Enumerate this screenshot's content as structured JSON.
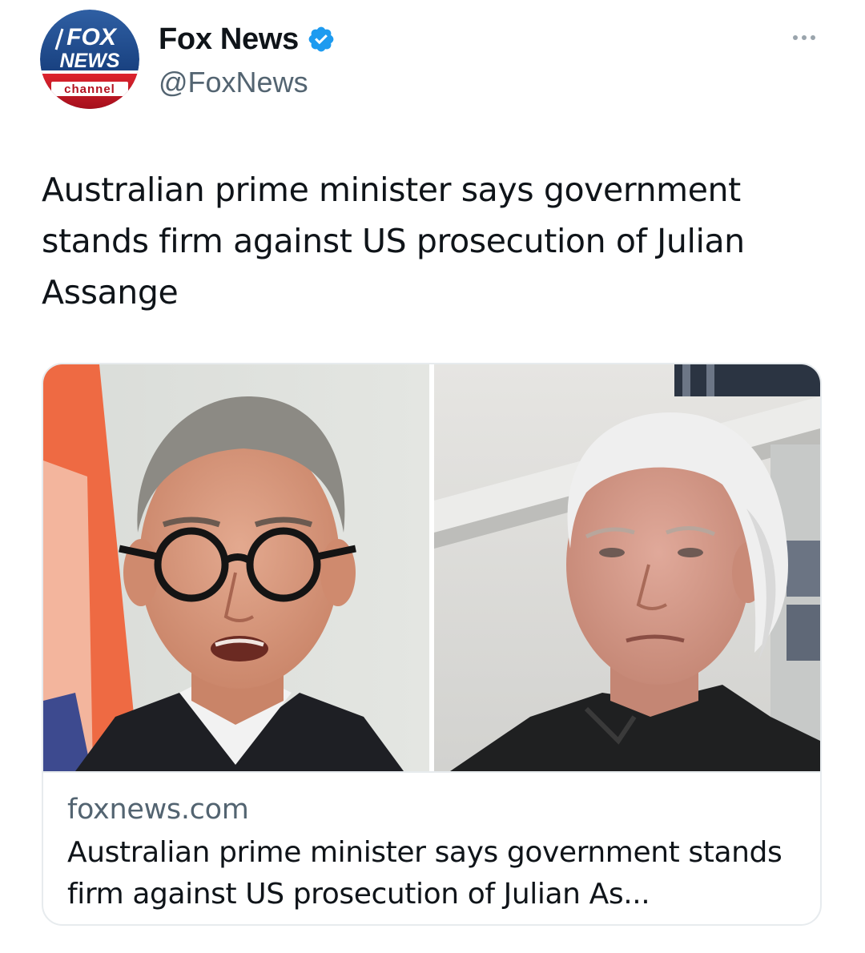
{
  "author": {
    "name": "Fox News",
    "handle": "@FoxNews",
    "verified": true,
    "avatar_logo_text": [
      "FOX",
      "NEWS",
      "channel"
    ]
  },
  "tweet": {
    "text": "Australian prime minister says government stands firm against US prosecution of Julian Assange"
  },
  "card": {
    "domain": "foxnews.com",
    "title": "Australian prime minister says government stands firm against US prosecution of Julian As..."
  },
  "icons": {
    "verified": "verified-badge-icon",
    "more": "more-options-icon"
  },
  "colors": {
    "verified_blue": "#1d9bf0",
    "secondary_text": "#536471",
    "primary_text": "#0f1419",
    "fox_blue": "#0b2f6b",
    "fox_red": "#c8102e"
  }
}
